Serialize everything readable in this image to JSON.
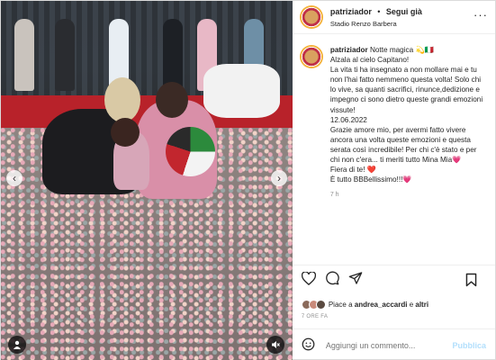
{
  "header": {
    "username": "patriziador",
    "separator": "•",
    "follow_label": "Segui già",
    "location": "Stadio Renzo Barbera",
    "more_icon": "more-horizontal-icon"
  },
  "caption": {
    "username": "patriziador",
    "lines": [
      "Notte magica 💫🇮🇹",
      "Alzala al cielo Capitano!",
      "La vita ti ha insegnato a non mollare mai e tu non l'hai fatto nemmeno questa volta! Solo chi lo vive, sa quanti sacrifici, rinunce,dedizione e impegno ci sono dietro queste grandi emozioni vissute!",
      "12.06.2022",
      "Grazie amore mio, per avermi fatto vivere ancora una volta queste emozioni e questa serata così incredibile! Per chi c'è stato e per chi non c'era... ti meriti tutto Mina Mia💗",
      "Fiera di te! ❤️",
      "È tutto BBBellissimo!!!💗"
    ],
    "time": "7 h"
  },
  "actions": {
    "like_icon": "heart-icon",
    "comment_icon": "comment-icon",
    "share_icon": "send-icon",
    "save_icon": "bookmark-icon"
  },
  "likes": {
    "prefix": "Piace a",
    "user": "andrea_accardi",
    "suffix": "e",
    "others": "altri"
  },
  "timestamp": "7 ORE FA",
  "comment": {
    "emoji_icon": "smiley-icon",
    "placeholder": "Aggiungi un commento...",
    "publish_label": "Pubblica"
  },
  "media": {
    "prev_icon": "chevron-left-icon",
    "next_icon": "chevron-right-icon",
    "tag_icon": "user-tag-icon",
    "mute_icon": "mute-icon"
  },
  "colors": {
    "publish": "#b2dffc",
    "text": "#262626",
    "muted": "#8e8e8e"
  }
}
